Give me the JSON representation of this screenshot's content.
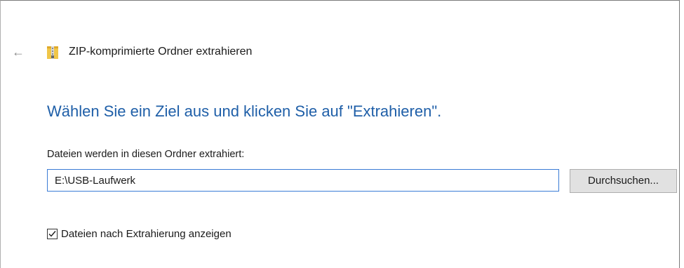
{
  "window": {
    "title": "ZIP-komprimierte Ordner extrahieren",
    "back_icon": "back-arrow-icon",
    "title_icon": "zip-folder-icon"
  },
  "content": {
    "instruction": "Wählen Sie ein Ziel aus und klicken Sie auf \"Extrahieren\".",
    "folder_label": "Dateien werden in diesen Ordner extrahiert:",
    "path_value": "E:\\USB-Laufwerk",
    "browse_label": "Durchsuchen...",
    "show_files_label": "Dateien nach Extrahierung anzeigen",
    "show_files_checked": true
  },
  "colors": {
    "instruction_text": "#1f5fa8",
    "input_border_focus": "#3a7bd5",
    "button_bg": "#e1e1e1"
  }
}
